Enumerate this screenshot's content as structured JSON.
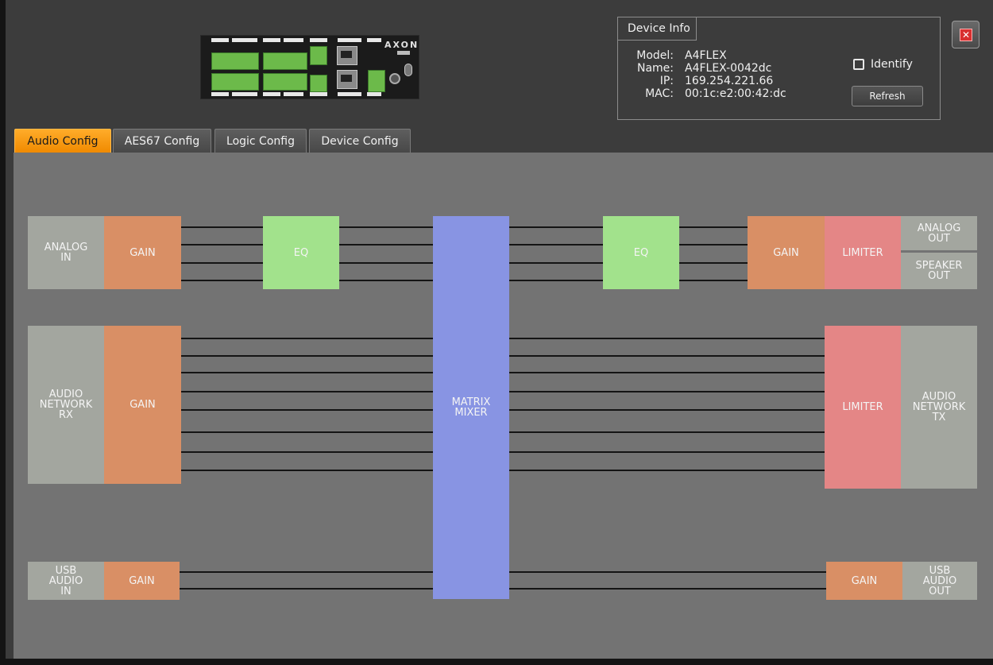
{
  "window": {
    "close_button": "close",
    "device_image_label": "AXON"
  },
  "device_info": {
    "title": "Device Info",
    "keys": {
      "model": "Model:",
      "name": "Name:",
      "ip": "IP:",
      "mac": "MAC:"
    },
    "values": {
      "model": "A4FLEX",
      "name": "A4FLEX-0042dc",
      "ip": "169.254.221.66",
      "mac": "00:1c:e2:00:42:dc"
    },
    "identify_label": "Identify",
    "identify_checked": false,
    "refresh_label": "Refresh"
  },
  "tabs": [
    {
      "label": "Audio Config",
      "active": true
    },
    {
      "label": "AES67 Config",
      "active": false
    },
    {
      "label": "Logic Config",
      "active": false
    },
    {
      "label": "Device Config",
      "active": false
    }
  ],
  "blocks": {
    "analog_in": "ANALOG\nIN",
    "analog_gain": "GAIN",
    "eq_in": "EQ",
    "matrix_mixer": "MATRIX\nMIXER",
    "eq_out": "EQ",
    "out_gain": "GAIN",
    "limiter_analog": "LIMITER",
    "analog_out": "ANALOG\nOUT",
    "speaker_out": "SPEAKER\nOUT",
    "network_rx": "AUDIO\nNETWORK\nRX",
    "network_gain": "GAIN",
    "limiter_network": "LIMITER",
    "network_tx": "AUDIO\nNETWORK\nTX",
    "usb_in": "USB\nAUDIO\nIN",
    "usb_in_gain": "GAIN",
    "usb_out_gain": "GAIN",
    "usb_out": "USB\nAUDIO\nOUT"
  },
  "colors": {
    "tab_active": "#f08a00",
    "block_grey": "#a3a69f",
    "block_orange": "#d98f65",
    "block_green": "#a2e28c",
    "block_blue": "#8894e3",
    "block_red": "#e48686",
    "panel": "#737373"
  }
}
